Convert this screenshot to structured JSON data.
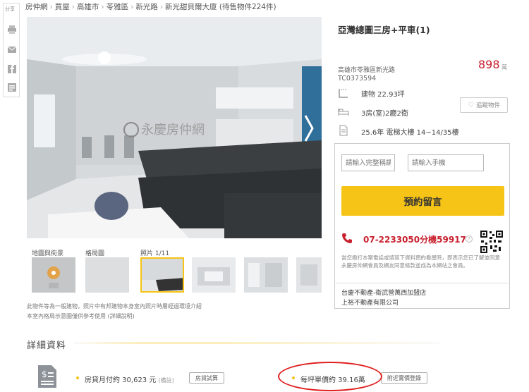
{
  "rail": {
    "share_label": "分享"
  },
  "breadcrumb": [
    "房仲網",
    "買屋",
    "高雄市",
    "苓雅區",
    "新光路",
    "新光甜貝爾大廈 (待售物件224件)"
  ],
  "breadcrumb_sep": "›",
  "gallery": {
    "watermark": "永慶房仲網",
    "labels": {
      "map": "地圖與街景",
      "floorplan": "格局圖",
      "photos": "照片 1/11"
    },
    "note_line1": "此物件等為一般建物，照片中有邦建物本身室內照片時層經過環境介紹",
    "note_line2": "本室內格局示意圖僅供參考使用 (詳細說明)"
  },
  "listing": {
    "title": "亞灣總圖三房+平車(1)",
    "address": "高雄市苓雅區新光路",
    "code": "TC0373594",
    "price": "898",
    "price_unit": "萬",
    "area": "建物 22.93坪",
    "rooms": "3房(室)2廳2衛",
    "age_floor": "25.6年  電梯大樓  14~14/35樓",
    "track_label": "追蹤物件"
  },
  "form": {
    "name_placeholder": "請輸入完整稱謂",
    "phone_placeholder": "請輸入手機",
    "submit_label": "預約留言",
    "phone": "07-2233050分機59917",
    "disclaimer": "當您撥打本案電話或填寫下資料預約看屋時，即表示您已了解並同意永慶房仲網會員及網友同意條款並成為本網站之會員。",
    "agent_line1": "台慶不動產-衛武營萬西加盟店",
    "agent_line2": "上裕不動產有限公司"
  },
  "details": {
    "section_title": "詳細資料",
    "mortgage_label": "房貸月付約 30,623 元",
    "mortgage_note": "(備註)",
    "mortgage_btn": "房貸試算",
    "unit_price_label": "每坪單價約 39.16萬",
    "nearby_btn": "附近實價登錄"
  },
  "colors": {
    "accent": "#f6c417",
    "price": "#c8202e",
    "highlight": "#e02020"
  }
}
